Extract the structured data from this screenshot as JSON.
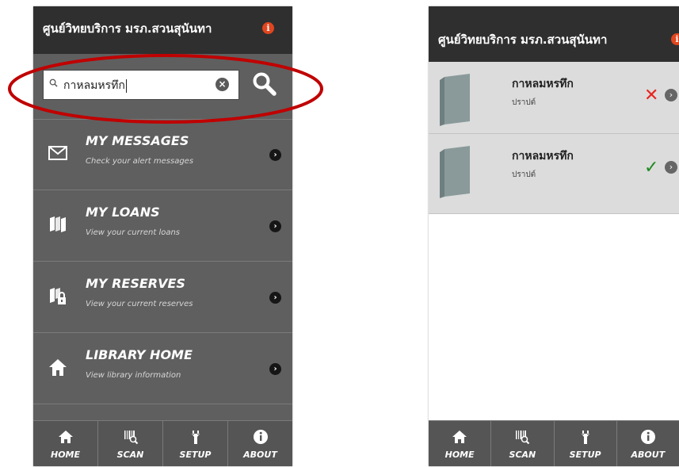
{
  "left": {
    "app_title": "ศูนย์วิทยบริการ มรภ.สวนสุนันทา",
    "info_icon": "info-icon",
    "search": {
      "value": "กาหลมหรทึก",
      "clear_icon": "clear-icon",
      "search_icon": "search-icon"
    },
    "menu": [
      {
        "title": "MY MESSAGES",
        "subtitle": "Check your alert messages",
        "icon": "envelope-icon"
      },
      {
        "title": "MY LOANS",
        "subtitle": "View your current loans",
        "icon": "books-icon"
      },
      {
        "title": "MY RESERVES",
        "subtitle": "View your current reserves",
        "icon": "locked-books-icon"
      },
      {
        "title": "LIBRARY HOME",
        "subtitle": "View library information",
        "icon": "home-icon"
      }
    ],
    "tabs": [
      "HOME",
      "SCAN",
      "SETUP",
      "ABOUT"
    ]
  },
  "right": {
    "app_title": "ศูนย์วิทยบริการ มรภ.สวนสุนันทา",
    "results": [
      {
        "title": "กาหลมหรทึก",
        "author": "ปราปต์",
        "status_color": "#e8251f",
        "status_icon": "cross-icon"
      },
      {
        "title": "กาหลมหรทึก",
        "author": "ปราปต์",
        "status_color": "#1e8a1e",
        "status_icon": "check-icon"
      }
    ],
    "tabs": [
      "HOME",
      "SCAN",
      "SETUP",
      "ABOUT"
    ]
  },
  "colors": {
    "header": "#2f2f2f",
    "panel": "#5f5f5f",
    "highlight_ellipse": "#c00000",
    "info": "#e0461f"
  }
}
